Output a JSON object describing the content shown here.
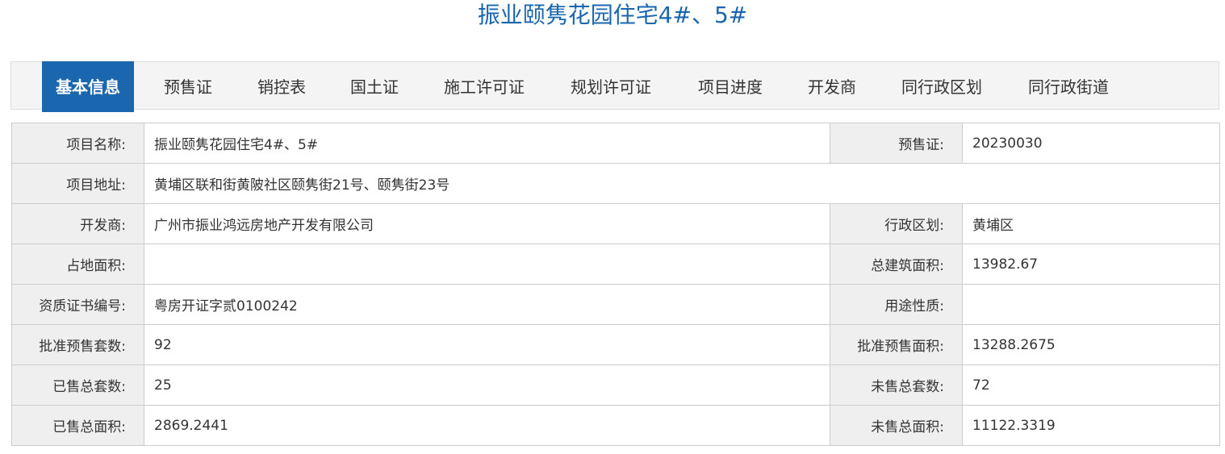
{
  "title": "振业颐隽花园住宅4#、5#",
  "tabs": [
    {
      "label": "基本信息",
      "active": true
    },
    {
      "label": "预售证",
      "active": false
    },
    {
      "label": "销控表",
      "active": false
    },
    {
      "label": "国土证",
      "active": false
    },
    {
      "label": "施工许可证",
      "active": false
    },
    {
      "label": "规划许可证",
      "active": false
    },
    {
      "label": "项目进度",
      "active": false
    },
    {
      "label": "开发商",
      "active": false
    },
    {
      "label": "同行政区划",
      "active": false
    },
    {
      "label": "同行政街道",
      "active": false
    }
  ],
  "info": {
    "project_name_label": "项目名称:",
    "project_name": "振业颐隽花园住宅4#、5#",
    "presale_cert_label": "预售证:",
    "presale_cert": "20230030",
    "address_label": "项目地址:",
    "address": "黄埔区联和街黄陂社区颐隽街21号、颐隽街23号",
    "developer_label": "开发商:",
    "developer": "广州市振业鸿远房地产开发有限公司",
    "district_label": "行政区划:",
    "district": "黄埔区",
    "land_area_label": "占地面积:",
    "land_area": "",
    "total_building_area_label": "总建筑面积:",
    "total_building_area": "13982.67",
    "qualification_label": "资质证书编号:",
    "qualification": "粤房开证字贰0100242",
    "usage_label": "用途性质:",
    "usage": "",
    "approved_units_label": "批准预售套数:",
    "approved_units": "92",
    "approved_area_label": "批准预售面积:",
    "approved_area": "13288.2675",
    "sold_units_label": "已售总套数:",
    "sold_units": "25",
    "unsold_units_label": "未售总套数:",
    "unsold_units": "72",
    "sold_area_label": "已售总面积:",
    "sold_area": "2869.2441",
    "unsold_area_label": "未售总面积:",
    "unsold_area": "11122.3319"
  },
  "colors": {
    "accent": "#1a67b0",
    "tab_bar_bg": "#f4f4f4",
    "label_cell_bg": "#efefef",
    "border": "#cccccc"
  }
}
